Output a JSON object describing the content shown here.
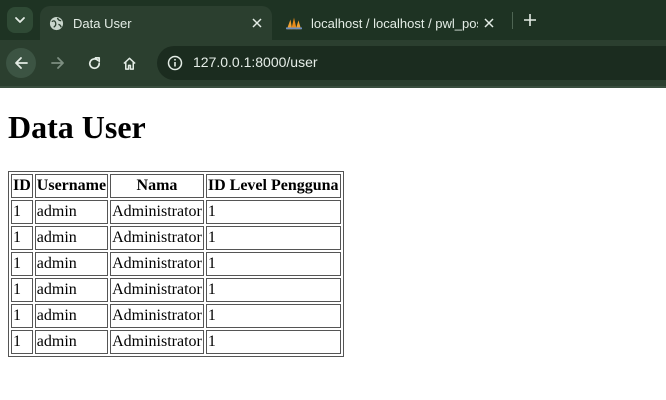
{
  "browser": {
    "tabs": [
      {
        "title": "Data User",
        "active": true
      },
      {
        "title": "localhost / localhost / pwl_pos / ",
        "active": false
      }
    ],
    "url": "127.0.0.1:8000/user"
  },
  "page": {
    "heading": "Data User",
    "table": {
      "headers": [
        "ID",
        "Username",
        "Nama",
        "ID Level Pengguna"
      ],
      "rows": [
        [
          "1",
          "admin",
          "Administrator",
          "1"
        ],
        [
          "1",
          "admin",
          "Administrator",
          "1"
        ],
        [
          "1",
          "admin",
          "Administrator",
          "1"
        ],
        [
          "1",
          "admin",
          "Administrator",
          "1"
        ],
        [
          "1",
          "admin",
          "Administrator",
          "1"
        ],
        [
          "1",
          "admin",
          "Administrator",
          "1"
        ]
      ]
    }
  },
  "colors": {
    "tabstrip": "#1e3323",
    "toolbar": "#2b3f2f",
    "omnibox": "#1b2c1f"
  }
}
